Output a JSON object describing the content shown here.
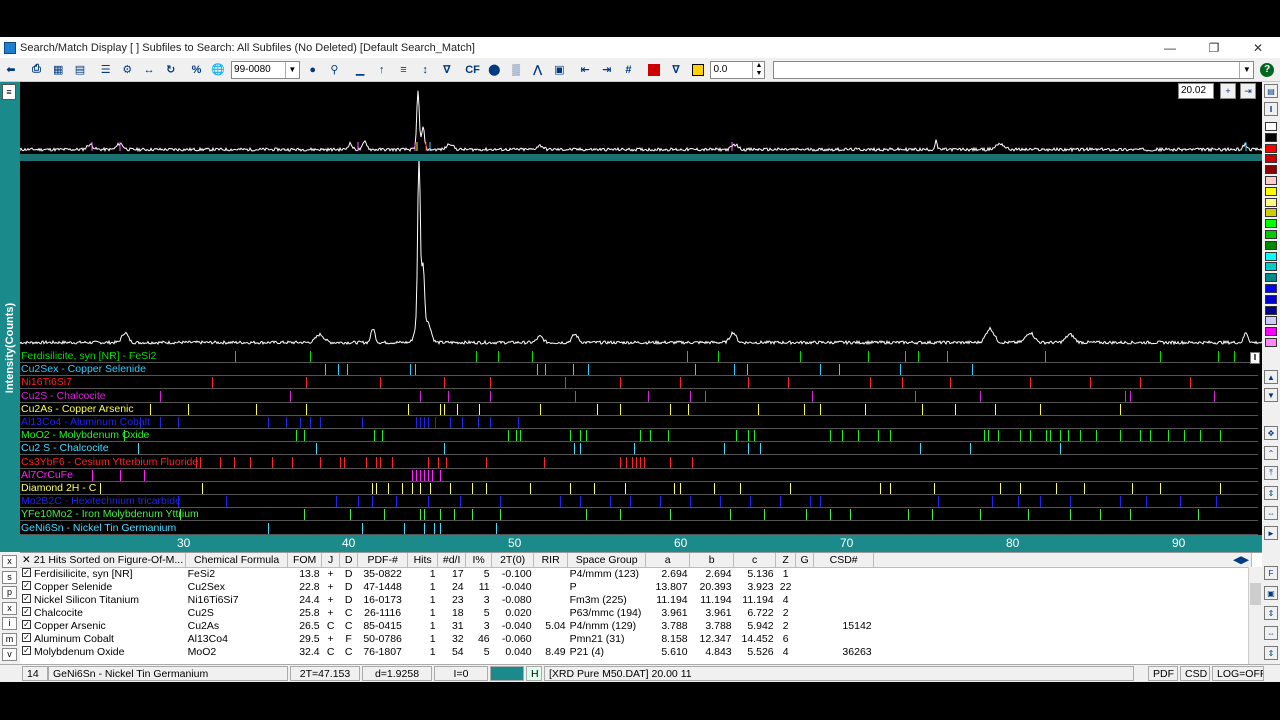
{
  "window": {
    "title": "Search/Match Display [ ] Subfiles to Search: All Subfiles (No Deleted) [Default Search_Match]",
    "minimize_icon": "minimize-icon",
    "maximize_icon": "restore-icon",
    "close_icon": "close-icon"
  },
  "toolbar": {
    "pdf_number": "99-0080",
    "threshold_value": "0.0",
    "search_text": "",
    "cf_label": "CF"
  },
  "plot": {
    "ylabel": "Intensity(Counts)",
    "zoom_value": "20.02",
    "x_ticks": [
      "30",
      "40",
      "50",
      "60",
      "70",
      "80",
      "90"
    ]
  },
  "colors": {
    "plot_bg": "#000000",
    "teal": "#1a8a8a",
    "trace": "#ffffff"
  },
  "phases": [
    {
      "label": "Ferdisilicite, syn [NR] - FeSi2",
      "color": "#00dd00"
    },
    {
      "label": "Cu2Sex - Copper Selenide",
      "color": "#33ccff"
    },
    {
      "label": "Ni16Ti6Si7",
      "color": "#ff2222"
    },
    {
      "label": "Cu2S - Chalcocite",
      "color": "#dd22dd"
    },
    {
      "label": "Cu2As - Copper Arsenic",
      "color": "#ffff44"
    },
    {
      "label": "Al13Co4 - Aluminum Cobalt",
      "color": "#2222ee"
    },
    {
      "label": "MoO2 - Molybdenum Oxide",
      "color": "#22ee22"
    },
    {
      "label": "Cu2 S - Chalcocite",
      "color": "#44ddff"
    },
    {
      "label": "Cs3YbF6 - Cesium Ytterbium Fluoride",
      "color": "#ff2222"
    },
    {
      "label": "Al7CrCuFe",
      "color": "#ff22ff"
    },
    {
      "label": "Diamond 2H - C",
      "color": "#ffff66"
    },
    {
      "label": "Mo2B2C - Hexitechnium tricarbide",
      "color": "#2222ee"
    },
    {
      "label": "YFe10Mo2 - Iron Molybdenum Yttrium",
      "color": "#44ee44"
    },
    {
      "label": "GeNi6Sn - Nickel Tin Germanium",
      "color": "#44ddff"
    }
  ],
  "table": {
    "hits_header": "21 Hits Sorted on Figure-Of-M...",
    "columns": [
      "Chemical Formula",
      "FOM",
      "J",
      "D",
      "PDF-#",
      "Hits",
      "#d/I",
      "I%",
      "2T(0)",
      "RIR",
      "Space Group",
      "a",
      "b",
      "c",
      "Z",
      "G",
      "CSD#"
    ],
    "rows": [
      {
        "name": "Ferdisilicite, syn [NR]",
        "formula": "FeSi2",
        "fom": "13.8",
        "j": "+",
        "d": "D",
        "pdf": "35-0822",
        "hits": "1",
        "dI": "17",
        "ipct": "5",
        "t0": "-0.100",
        "rir": "",
        "sg": "P4/mmm (123)",
        "a": "2.694",
        "b": "2.694",
        "c": "5.136",
        "z": "1",
        "g": "",
        "csd": ""
      },
      {
        "name": "Copper Selenide",
        "formula": "Cu2Sex",
        "fom": "22.8",
        "j": "+",
        "d": "D",
        "pdf": "47-1448",
        "hits": "1",
        "dI": "24",
        "ipct": "11",
        "t0": "-0.040",
        "rir": "",
        "sg": "P",
        "a": "13.807",
        "b": "20.393",
        "c": "3.923",
        "z": "22",
        "g": "",
        "csd": ""
      },
      {
        "name": "Nickel Silicon Titanium",
        "formula": "Ni16Ti6Si7",
        "fom": "24.4",
        "j": "+",
        "d": "D",
        "pdf": "16-0173",
        "hits": "1",
        "dI": "23",
        "ipct": "3",
        "t0": "-0.080",
        "rir": "",
        "sg": "Fm3m (225)",
        "a": "11.194",
        "b": "11.194",
        "c": "11.194",
        "z": "4",
        "g": "",
        "csd": ""
      },
      {
        "name": "Chalcocite",
        "formula": "Cu2S",
        "fom": "25.8",
        "j": "+",
        "d": "C",
        "pdf": "26-1116",
        "hits": "1",
        "dI": "18",
        "ipct": "5",
        "t0": "0.020",
        "rir": "",
        "sg": "P63/mmc (194)",
        "a": "3.961",
        "b": "3.961",
        "c": "6.722",
        "z": "2",
        "g": "",
        "csd": ""
      },
      {
        "name": "Copper Arsenic",
        "formula": "Cu2As",
        "fom": "26.5",
        "j": "C",
        "d": "C",
        "pdf": "85-0415",
        "hits": "1",
        "dI": "31",
        "ipct": "3",
        "t0": "-0.040",
        "rir": "5.04",
        "sg": "P4/nmm (129)",
        "a": "3.788",
        "b": "3.788",
        "c": "5.942",
        "z": "2",
        "g": "",
        "csd": "15142"
      },
      {
        "name": "Aluminum Cobalt",
        "formula": "Al13Co4",
        "fom": "29.5",
        "j": "+",
        "d": "F",
        "pdf": "50-0786",
        "hits": "1",
        "dI": "32",
        "ipct": "46",
        "t0": "-0.060",
        "rir": "",
        "sg": "Pmn21 (31)",
        "a": "8.158",
        "b": "12.347",
        "c": "14.452",
        "z": "6",
        "g": "",
        "csd": ""
      },
      {
        "name": "Molybdenum Oxide",
        "formula": "MoO2",
        "fom": "32.4",
        "j": "C",
        "d": "C",
        "pdf": "76-1807",
        "hits": "1",
        "dI": "54",
        "ipct": "5",
        "t0": "0.040",
        "rir": "8.49",
        "sg": "P21 (4)",
        "a": "5.610",
        "b": "4.843",
        "c": "5.526",
        "z": "4",
        "g": "",
        "csd": "36263"
      }
    ]
  },
  "left_tabs": [
    "x",
    "s",
    "p",
    "x",
    "i",
    "m",
    "v"
  ],
  "status": {
    "index": "14",
    "phase": "GeNi6Sn - Nickel Tin Germanium",
    "two_theta": "2T=47.153",
    "d_spacing": "d=1.9258",
    "intensity": "I=0",
    "h_label": "H",
    "file": "[XRD Pure M50.DAT] 20.00  11",
    "pdf_label": "PDF",
    "csd_label": "CSD",
    "log_label": "LOG=OFF"
  },
  "palette": [
    "#ffffff",
    "#000000",
    "#ff0000",
    "#cc0000",
    "#880000",
    "#ffcccc",
    "#ffff00",
    "#ffff88",
    "#cccc00",
    "#00ff00",
    "#00cc00",
    "#008800",
    "#00ffff",
    "#00cccc",
    "#008888",
    "#0000ff",
    "#0000cc",
    "#000088",
    "#ccccff",
    "#ff00ff",
    "#ff88ff"
  ]
}
